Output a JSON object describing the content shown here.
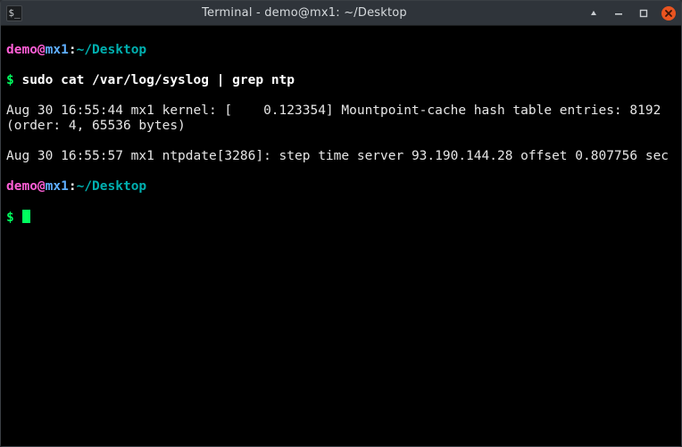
{
  "window": {
    "title": "Terminal - demo@mx1: ~/Desktop",
    "app_icon_glyph": "$_"
  },
  "prompt": {
    "user": "demo",
    "at": "@",
    "host": "mx1",
    "sep": ":",
    "path": "~/Desktop",
    "dollar": "$"
  },
  "session": [
    {
      "type": "cmd",
      "text": " sudo cat /var/log/syslog | grep ntp"
    },
    {
      "type": "out",
      "text": "Aug 30 16:55:44 mx1 kernel: [    0.123354] Mountpoint-cache hash table entries: 8192 (order: 4, 65536 bytes)"
    },
    {
      "type": "out",
      "text": "Aug 30 16:55:57 mx1 ntpdate[3286]: step time server 93.190.144.28 offset 0.807756 sec"
    }
  ]
}
